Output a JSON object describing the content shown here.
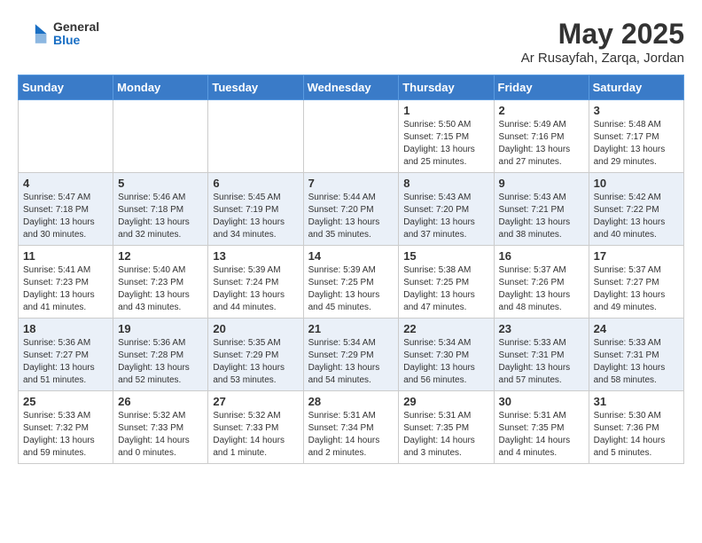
{
  "header": {
    "logo_general": "General",
    "logo_blue": "Blue",
    "month_title": "May 2025",
    "location": "Ar Rusayfah, Zarqa, Jordan"
  },
  "weekdays": [
    "Sunday",
    "Monday",
    "Tuesday",
    "Wednesday",
    "Thursday",
    "Friday",
    "Saturday"
  ],
  "weeks": [
    [
      {
        "day": "",
        "info": ""
      },
      {
        "day": "",
        "info": ""
      },
      {
        "day": "",
        "info": ""
      },
      {
        "day": "",
        "info": ""
      },
      {
        "day": "1",
        "info": "Sunrise: 5:50 AM\nSunset: 7:15 PM\nDaylight: 13 hours\nand 25 minutes."
      },
      {
        "day": "2",
        "info": "Sunrise: 5:49 AM\nSunset: 7:16 PM\nDaylight: 13 hours\nand 27 minutes."
      },
      {
        "day": "3",
        "info": "Sunrise: 5:48 AM\nSunset: 7:17 PM\nDaylight: 13 hours\nand 29 minutes."
      }
    ],
    [
      {
        "day": "4",
        "info": "Sunrise: 5:47 AM\nSunset: 7:18 PM\nDaylight: 13 hours\nand 30 minutes."
      },
      {
        "day": "5",
        "info": "Sunrise: 5:46 AM\nSunset: 7:18 PM\nDaylight: 13 hours\nand 32 minutes."
      },
      {
        "day": "6",
        "info": "Sunrise: 5:45 AM\nSunset: 7:19 PM\nDaylight: 13 hours\nand 34 minutes."
      },
      {
        "day": "7",
        "info": "Sunrise: 5:44 AM\nSunset: 7:20 PM\nDaylight: 13 hours\nand 35 minutes."
      },
      {
        "day": "8",
        "info": "Sunrise: 5:43 AM\nSunset: 7:20 PM\nDaylight: 13 hours\nand 37 minutes."
      },
      {
        "day": "9",
        "info": "Sunrise: 5:43 AM\nSunset: 7:21 PM\nDaylight: 13 hours\nand 38 minutes."
      },
      {
        "day": "10",
        "info": "Sunrise: 5:42 AM\nSunset: 7:22 PM\nDaylight: 13 hours\nand 40 minutes."
      }
    ],
    [
      {
        "day": "11",
        "info": "Sunrise: 5:41 AM\nSunset: 7:23 PM\nDaylight: 13 hours\nand 41 minutes."
      },
      {
        "day": "12",
        "info": "Sunrise: 5:40 AM\nSunset: 7:23 PM\nDaylight: 13 hours\nand 43 minutes."
      },
      {
        "day": "13",
        "info": "Sunrise: 5:39 AM\nSunset: 7:24 PM\nDaylight: 13 hours\nand 44 minutes."
      },
      {
        "day": "14",
        "info": "Sunrise: 5:39 AM\nSunset: 7:25 PM\nDaylight: 13 hours\nand 45 minutes."
      },
      {
        "day": "15",
        "info": "Sunrise: 5:38 AM\nSunset: 7:25 PM\nDaylight: 13 hours\nand 47 minutes."
      },
      {
        "day": "16",
        "info": "Sunrise: 5:37 AM\nSunset: 7:26 PM\nDaylight: 13 hours\nand 48 minutes."
      },
      {
        "day": "17",
        "info": "Sunrise: 5:37 AM\nSunset: 7:27 PM\nDaylight: 13 hours\nand 49 minutes."
      }
    ],
    [
      {
        "day": "18",
        "info": "Sunrise: 5:36 AM\nSunset: 7:27 PM\nDaylight: 13 hours\nand 51 minutes."
      },
      {
        "day": "19",
        "info": "Sunrise: 5:36 AM\nSunset: 7:28 PM\nDaylight: 13 hours\nand 52 minutes."
      },
      {
        "day": "20",
        "info": "Sunrise: 5:35 AM\nSunset: 7:29 PM\nDaylight: 13 hours\nand 53 minutes."
      },
      {
        "day": "21",
        "info": "Sunrise: 5:34 AM\nSunset: 7:29 PM\nDaylight: 13 hours\nand 54 minutes."
      },
      {
        "day": "22",
        "info": "Sunrise: 5:34 AM\nSunset: 7:30 PM\nDaylight: 13 hours\nand 56 minutes."
      },
      {
        "day": "23",
        "info": "Sunrise: 5:33 AM\nSunset: 7:31 PM\nDaylight: 13 hours\nand 57 minutes."
      },
      {
        "day": "24",
        "info": "Sunrise: 5:33 AM\nSunset: 7:31 PM\nDaylight: 13 hours\nand 58 minutes."
      }
    ],
    [
      {
        "day": "25",
        "info": "Sunrise: 5:33 AM\nSunset: 7:32 PM\nDaylight: 13 hours\nand 59 minutes."
      },
      {
        "day": "26",
        "info": "Sunrise: 5:32 AM\nSunset: 7:33 PM\nDaylight: 14 hours\nand 0 minutes."
      },
      {
        "day": "27",
        "info": "Sunrise: 5:32 AM\nSunset: 7:33 PM\nDaylight: 14 hours\nand 1 minute."
      },
      {
        "day": "28",
        "info": "Sunrise: 5:31 AM\nSunset: 7:34 PM\nDaylight: 14 hours\nand 2 minutes."
      },
      {
        "day": "29",
        "info": "Sunrise: 5:31 AM\nSunset: 7:35 PM\nDaylight: 14 hours\nand 3 minutes."
      },
      {
        "day": "30",
        "info": "Sunrise: 5:31 AM\nSunset: 7:35 PM\nDaylight: 14 hours\nand 4 minutes."
      },
      {
        "day": "31",
        "info": "Sunrise: 5:30 AM\nSunset: 7:36 PM\nDaylight: 14 hours\nand 5 minutes."
      }
    ]
  ]
}
